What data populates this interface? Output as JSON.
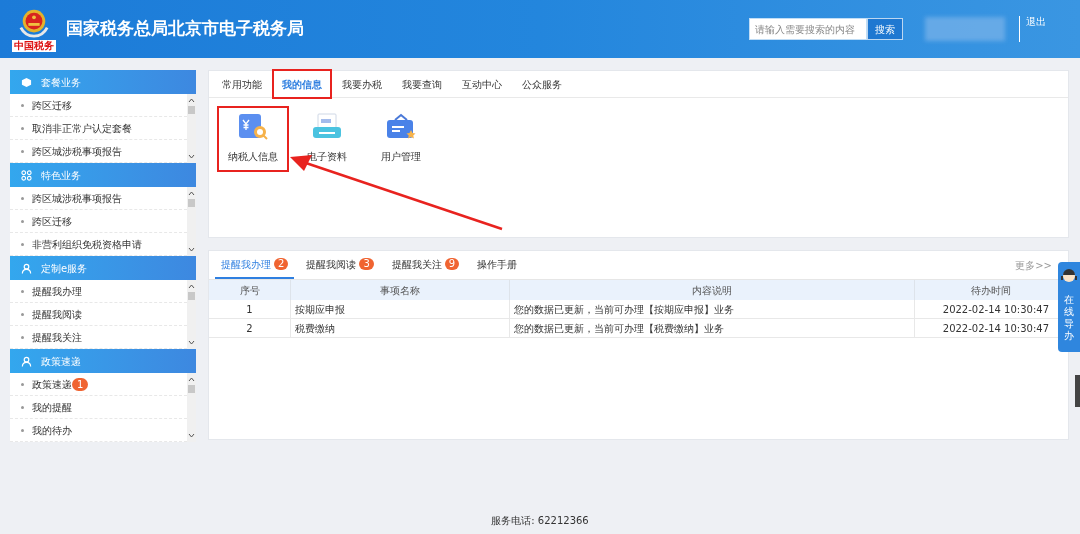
{
  "header": {
    "logo_caption": "中国税务",
    "title": "国家税务总局北京市电子税务局",
    "search": {
      "placeholder": "请输入需要搜索的内容",
      "button": "搜索"
    },
    "logout": "退出"
  },
  "sidebar": [
    {
      "title": "套餐业务",
      "kind": "cube",
      "items": [
        {
          "label": "跨区迁移"
        },
        {
          "label": "取消非正常户认定套餐"
        },
        {
          "label": "跨区城涉税事项报告"
        }
      ]
    },
    {
      "title": "特色业务",
      "kind": "grid",
      "items": [
        {
          "label": "跨区城涉税事项报告"
        },
        {
          "label": "跨区迁移"
        },
        {
          "label": "非营利组织免税资格申请"
        }
      ]
    },
    {
      "title": "定制e服务",
      "kind": "user",
      "items": [
        {
          "label": "提醒我办理"
        },
        {
          "label": "提醒我阅读"
        },
        {
          "label": "提醒我关注"
        }
      ]
    },
    {
      "title": "政策速递",
      "kind": "user",
      "items": [
        {
          "label": "政策速递",
          "badge": "1"
        },
        {
          "label": "我的提醒"
        },
        {
          "label": "我的待办"
        }
      ]
    }
  ],
  "function_tabs": [
    {
      "label": "常用功能",
      "selected": false,
      "annotated": false
    },
    {
      "label": "我的信息",
      "selected": true,
      "annotated": true
    },
    {
      "label": "我要办税",
      "selected": false,
      "annotated": false
    },
    {
      "label": "我要查询",
      "selected": false,
      "annotated": false
    },
    {
      "label": "互动中心",
      "selected": false,
      "annotated": false
    },
    {
      "label": "公众服务",
      "selected": false,
      "annotated": false
    }
  ],
  "tiles": [
    {
      "label": "纳税人信息",
      "kind": "taxpayer",
      "annotated": true
    },
    {
      "label": "电子资料",
      "kind": "printer",
      "annotated": false
    },
    {
      "label": "用户管理",
      "kind": "card",
      "annotated": false
    }
  ],
  "reminder_tabs": [
    {
      "label": "提醒我办理",
      "badge": "2",
      "selected": true
    },
    {
      "label": "提醒我阅读",
      "badge": "3",
      "selected": false
    },
    {
      "label": "提醒我关注",
      "badge": "9",
      "selected": false
    },
    {
      "label": "操作手册",
      "selected": false
    }
  ],
  "more_link": "更多>>",
  "table": {
    "columns": [
      "序号",
      "事项名称",
      "内容说明",
      "待办时间"
    ],
    "rows": [
      [
        "1",
        "按期应申报",
        "您的数据已更新，当前可办理【按期应申报】业务",
        "2022-02-14 10:30:47"
      ],
      [
        "2",
        "税费缴纳",
        "您的数据已更新，当前可办理【税费缴纳】业务",
        "2022-02-14 10:30:47"
      ]
    ]
  },
  "online_guide": "在线导办",
  "footer": "服务电话: 62212366"
}
